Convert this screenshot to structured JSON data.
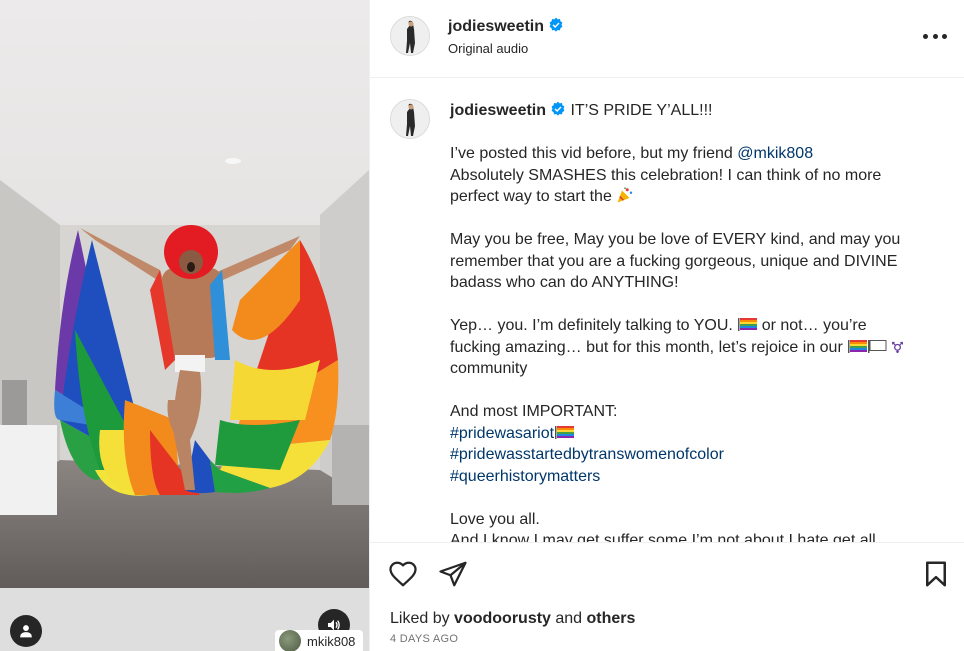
{
  "media": {
    "tagged_user": "mkik808",
    "tag_icon": "person-icon",
    "audio_icon": "speaker-icon"
  },
  "header": {
    "username": "jodiesweetin",
    "subtitle": "Original audio",
    "more_icon": "ellipsis-icon"
  },
  "caption": {
    "username": "jodiesweetin",
    "first_line": "IT’S PRIDE Y’ALL!!!",
    "p1_l1_pre": "I’ve posted this vid before, but my friend ",
    "p1_l1_mention": "@mkik808",
    "p1_l2": "Absolutely SMASHES this celebration! I can think of no more",
    "p1_l3": "perfect way to start the ",
    "p2_l1": "May you be free, May you be love of EVERY kind, and may you",
    "p2_l2": "remember that you are a fucking gorgeous, unique and DIVINE",
    "p2_l3": "badass who can do ANYTHING!",
    "p3_l1_pre": "Yep… you. I’m definitely talking to YOU. ",
    "p3_l1_post": " or not… you’re",
    "p3_l2": "fucking amazing… but for this month, let’s rejoice in our ",
    "p3_l3": "community",
    "p4_l1": "And most IMPORTANT:",
    "hashtag1": "#pridewasariot",
    "hashtag2": "#pridewasstartedbytranswomenofcolor",
    "hashtag3": "#queerhistorymatters",
    "p5_l1": "Love you all.",
    "p5_l2": "And I know I may get suffer some I’m not about I hate get all"
  },
  "actions": {
    "like_icon": "heart-icon",
    "share_icon": "paper-plane-icon",
    "save_icon": "bookmark-icon",
    "liked_by_prefix": "Liked by ",
    "liked_by_user": "voodoorusty",
    "liked_by_and": " and ",
    "liked_by_others": "others",
    "timestamp": "4 DAYS AGO"
  },
  "colors": {
    "link": "#00376b",
    "verified": "#0095f6",
    "text": "#262626",
    "muted": "#737373"
  }
}
